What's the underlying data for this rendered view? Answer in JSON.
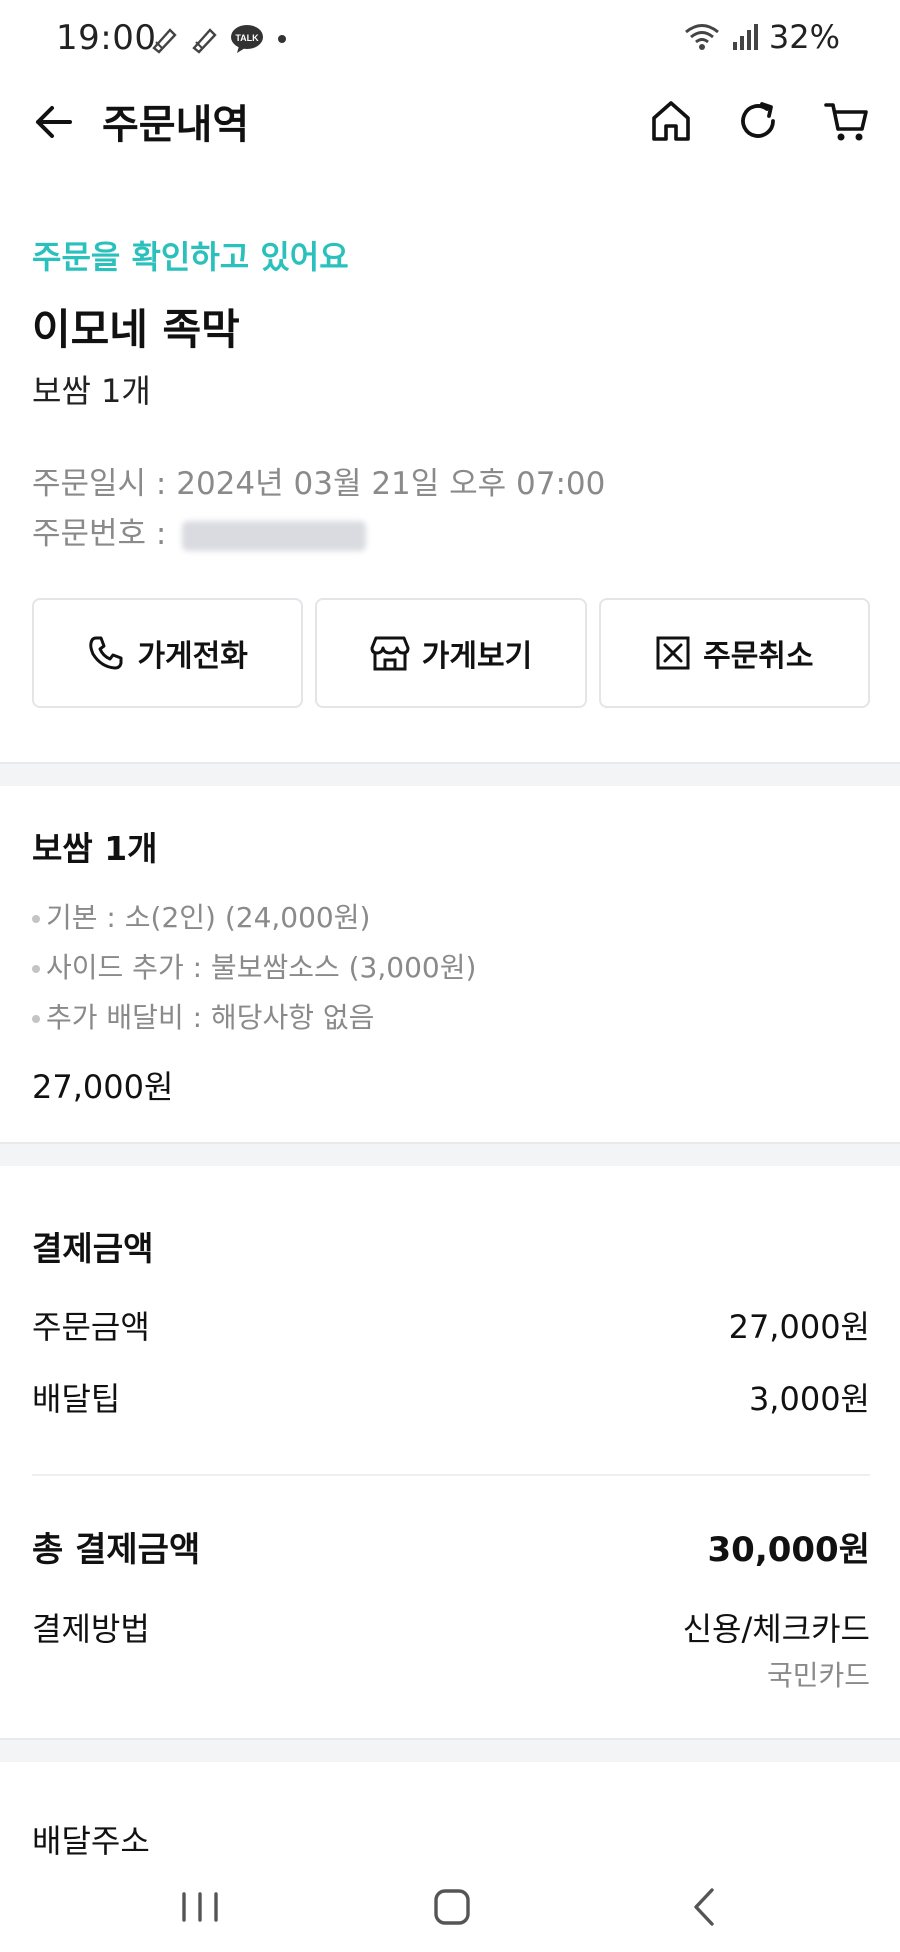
{
  "status_bar": {
    "time": "19:00",
    "battery": "32%",
    "icons_left": [
      "pen-icon",
      "pen-icon",
      "talk-icon",
      "dot-icon"
    ],
    "icons_right": [
      "wifi-icon",
      "signal-icon"
    ]
  },
  "header": {
    "title": "주문내역",
    "icons": [
      "back-arrow-icon",
      "home-icon",
      "refresh-icon",
      "cart-icon"
    ]
  },
  "order": {
    "status": "주문을 확인하고 있어요",
    "store_name": "이모네 족막",
    "summary": "보쌈 1개",
    "date_label": "주문일시 : ",
    "date_value": "2024년 03월 21일 오후 07:00",
    "number_label": "주문번호 : "
  },
  "actions": {
    "call": "가게전화",
    "store": "가게보기",
    "cancel": "주문취소"
  },
  "item": {
    "title": "보쌈 1개",
    "options": [
      "기본 : 소(2인) (24,000원)",
      "사이드 추가 : 불보쌈소스 (3,000원)",
      "추가 배달비 : 해당사항 없음"
    ],
    "price": "27,000원"
  },
  "payment": {
    "title": "결제금액",
    "order_amount_label": "주문금액",
    "order_amount_value": "27,000원",
    "delivery_tip_label": "배달팁",
    "delivery_tip_value": "3,000원",
    "total_label": "총 결제금액",
    "total_value": "30,000원",
    "method_label": "결제방법",
    "method_value": "신용/체크카드",
    "card_name": "국민카드"
  },
  "address": {
    "title": "배달주소"
  },
  "colors": {
    "accent": "#2ac1bc",
    "muted_text": "#8a8a8a",
    "divider": "#f3f4f6"
  }
}
